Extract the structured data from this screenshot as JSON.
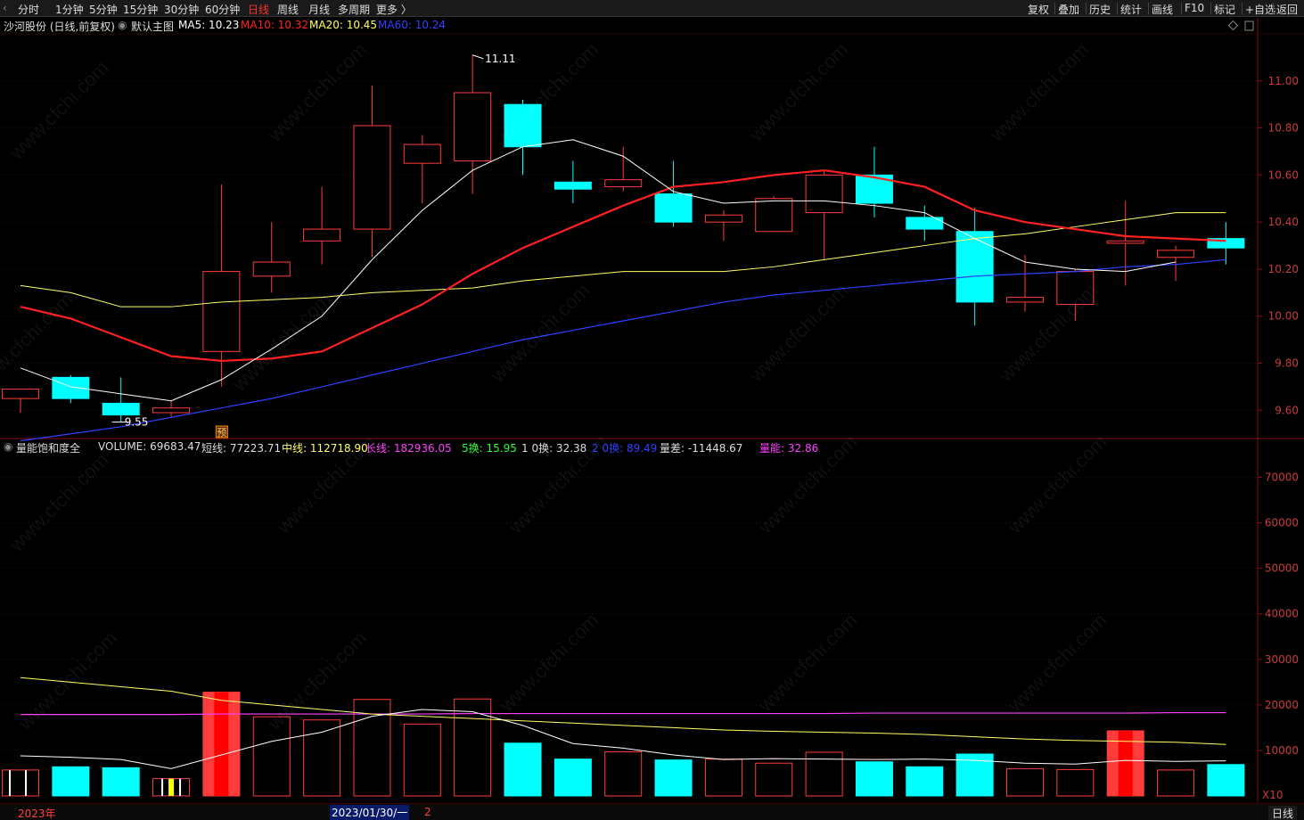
{
  "toolbar": {
    "periods": [
      {
        "label": "分时",
        "active": false
      },
      {
        "label": "1分钟",
        "active": false
      },
      {
        "label": "5分钟",
        "active": false
      },
      {
        "label": "15分钟",
        "active": false
      },
      {
        "label": "30分钟",
        "active": false
      },
      {
        "label": "60分钟",
        "active": false
      },
      {
        "label": "日线",
        "active": true
      },
      {
        "label": "周线",
        "active": false
      },
      {
        "label": "月线",
        "active": false
      },
      {
        "label": "多周期",
        "active": false
      },
      {
        "label": "更多 〉",
        "active": false
      }
    ],
    "right_buttons": [
      "复权",
      "叠加",
      "历史",
      "统计",
      "画线",
      "F10",
      "标记",
      "+自选",
      "返回"
    ]
  },
  "main_info": {
    "stock": "沙河股份 (日线,前复权)",
    "template": "默认主图",
    "ma5": "MA5: 10.23",
    "ma10": "MA10: 10.32",
    "ma20": "MA20: 10.45",
    "ma60": "MA60: 10.24"
  },
  "volume_info": {
    "indicator": "量能饱和度全",
    "volume": "VOLUME: 69683.47",
    "short": "短线: 77223.71",
    "mid": "中线: 112718.90",
    "long": "长线: 182936.05",
    "h5": "5换: 15.95",
    "h10": "1 0换: 32.38",
    "h20": "2 0换: 89.49",
    "diff": "量差: -11448.67",
    "energy": "量能: 32.86"
  },
  "annotations": {
    "high_label": "11.11",
    "low_label": "9.55",
    "forecast_badge": "预"
  },
  "bottom": {
    "year": "2023年",
    "date": "2023/01/30/一",
    "page": "2",
    "period": "日线",
    "scale": "X10"
  },
  "colors": {
    "up": "#ff3c3c",
    "down": "#00ffff",
    "ma5": "#ffffff",
    "ma10": "#ff2020",
    "ma20": "#ffff66",
    "ma60": "#3040ff",
    "energy": "#ff40ff",
    "axis": "#8a1010"
  },
  "chart_data": {
    "type": "candlestick",
    "price_axis": {
      "ticks": [
        "11.00",
        "10.80",
        "10.60",
        "10.40",
        "10.20",
        "10.00",
        "9.80",
        "9.60"
      ],
      "range": [
        9.48,
        11.2
      ]
    },
    "volume_axis": {
      "ticks": [
        "70000",
        "60000",
        "50000",
        "40000",
        "30000",
        "20000",
        "10000"
      ],
      "range": [
        0,
        75000
      ]
    },
    "candles": [
      {
        "o": 9.65,
        "h": 9.68,
        "l": 9.59,
        "c": 9.69,
        "v": 5700,
        "color": "up"
      },
      {
        "o": 9.74,
        "h": 9.75,
        "l": 9.63,
        "c": 9.65,
        "v": 6400,
        "color": "down"
      },
      {
        "o": 9.63,
        "h": 9.74,
        "l": 9.55,
        "c": 9.58,
        "v": 6200,
        "color": "down"
      },
      {
        "o": 9.59,
        "h": 9.64,
        "l": 9.57,
        "c": 9.61,
        "v": 3800,
        "color": "yellow"
      },
      {
        "o": 9.85,
        "h": 10.56,
        "l": 9.7,
        "c": 10.19,
        "v": 22800,
        "color": "up_filled"
      },
      {
        "o": 10.17,
        "h": 10.4,
        "l": 10.1,
        "c": 10.23,
        "v": 17400,
        "color": "up"
      },
      {
        "o": 10.32,
        "h": 10.55,
        "l": 10.22,
        "c": 10.37,
        "v": 16700,
        "color": "up"
      },
      {
        "o": 10.37,
        "h": 10.98,
        "l": 10.25,
        "c": 10.81,
        "v": 21200,
        "color": "up"
      },
      {
        "o": 10.65,
        "h": 10.77,
        "l": 10.48,
        "c": 10.73,
        "v": 15800,
        "color": "up"
      },
      {
        "o": 10.66,
        "h": 11.11,
        "l": 10.52,
        "c": 10.95,
        "v": 21300,
        "color": "up"
      },
      {
        "o": 10.9,
        "h": 10.92,
        "l": 10.6,
        "c": 10.72,
        "v": 11600,
        "color": "down"
      },
      {
        "o": 10.57,
        "h": 10.66,
        "l": 10.48,
        "c": 10.54,
        "v": 8100,
        "color": "down"
      },
      {
        "o": 10.55,
        "h": 10.72,
        "l": 10.53,
        "c": 10.58,
        "v": 9700,
        "color": "up"
      },
      {
        "o": 10.52,
        "h": 10.66,
        "l": 10.38,
        "c": 10.4,
        "v": 7900,
        "color": "down"
      },
      {
        "o": 10.4,
        "h": 10.45,
        "l": 10.32,
        "c": 10.43,
        "v": 8100,
        "color": "up"
      },
      {
        "o": 10.36,
        "h": 10.51,
        "l": 10.36,
        "c": 10.5,
        "v": 7200,
        "color": "up"
      },
      {
        "o": 10.44,
        "h": 10.62,
        "l": 10.24,
        "c": 10.6,
        "v": 9600,
        "color": "up"
      },
      {
        "o": 10.6,
        "h": 10.72,
        "l": 10.42,
        "c": 10.48,
        "v": 7500,
        "color": "down"
      },
      {
        "o": 10.42,
        "h": 10.47,
        "l": 10.32,
        "c": 10.37,
        "v": 6400,
        "color": "down"
      },
      {
        "o": 10.36,
        "h": 10.46,
        "l": 9.96,
        "c": 10.06,
        "v": 9200,
        "color": "down"
      },
      {
        "o": 10.06,
        "h": 10.26,
        "l": 10.02,
        "c": 10.08,
        "v": 6000,
        "color": "up"
      },
      {
        "o": 10.05,
        "h": 10.2,
        "l": 9.98,
        "c": 10.19,
        "v": 5800,
        "color": "up"
      },
      {
        "o": 10.31,
        "h": 10.49,
        "l": 10.13,
        "c": 10.32,
        "v": 14300,
        "color": "up_filled"
      },
      {
        "o": 10.25,
        "h": 10.3,
        "l": 10.15,
        "c": 10.28,
        "v": 5700,
        "color": "up"
      },
      {
        "o": 10.33,
        "h": 10.4,
        "l": 10.22,
        "c": 10.29,
        "v": 6900,
        "color": "down"
      }
    ],
    "ma5": [
      9.78,
      9.7,
      9.67,
      9.64,
      9.73,
      9.86,
      10.0,
      10.24,
      10.45,
      10.62,
      10.72,
      10.75,
      10.68,
      10.53,
      10.48,
      10.49,
      10.49,
      10.47,
      10.44,
      10.33,
      10.23,
      10.2,
      10.19,
      10.23
    ],
    "ma10": [
      10.04,
      9.99,
      9.91,
      9.83,
      9.81,
      9.82,
      9.85,
      9.95,
      10.05,
      10.18,
      10.29,
      10.38,
      10.47,
      10.55,
      10.57,
      10.6,
      10.62,
      10.59,
      10.55,
      10.45,
      10.4,
      10.37,
      10.34,
      10.33,
      10.32
    ],
    "ma20": [
      10.13,
      10.1,
      10.04,
      10.04,
      10.06,
      10.07,
      10.08,
      10.1,
      10.11,
      10.12,
      10.15,
      10.17,
      10.19,
      10.19,
      10.19,
      10.21,
      10.24,
      10.27,
      10.3,
      10.33,
      10.35,
      10.38,
      10.41,
      10.44,
      10.44
    ],
    "ma60": [
      9.47,
      9.5,
      9.53,
      9.57,
      9.61,
      9.65,
      9.7,
      9.75,
      9.8,
      9.85,
      9.9,
      9.94,
      9.98,
      10.02,
      10.06,
      10.09,
      10.11,
      10.13,
      10.15,
      10.17,
      10.18,
      10.19,
      10.21,
      10.22,
      10.24
    ],
    "vol_short": [
      8800,
      8500,
      8000,
      6000,
      9000,
      12000,
      14000,
      17500,
      19000,
      18500,
      15500,
      11500,
      10500,
      9000,
      8000,
      8200,
      8100,
      8000,
      8100,
      7800,
      7200,
      7000,
      7800,
      7600,
      7700
    ],
    "vol_mid": [
      26000,
      25000,
      24000,
      23000,
      21000,
      20000,
      19000,
      18000,
      17500,
      17000,
      16500,
      16000,
      15500,
      15000,
      14500,
      14200,
      14000,
      13800,
      13500,
      13000,
      12500,
      12200,
      12000,
      11800,
      11300
    ],
    "vol_long": [
      17900,
      17900,
      17900,
      17900,
      18000,
      18000,
      18000,
      18000,
      18000,
      18100,
      18100,
      18100,
      18100,
      18100,
      18100,
      18100,
      18100,
      18200,
      18200,
      18200,
      18200,
      18200,
      18200,
      18300,
      18300
    ]
  }
}
